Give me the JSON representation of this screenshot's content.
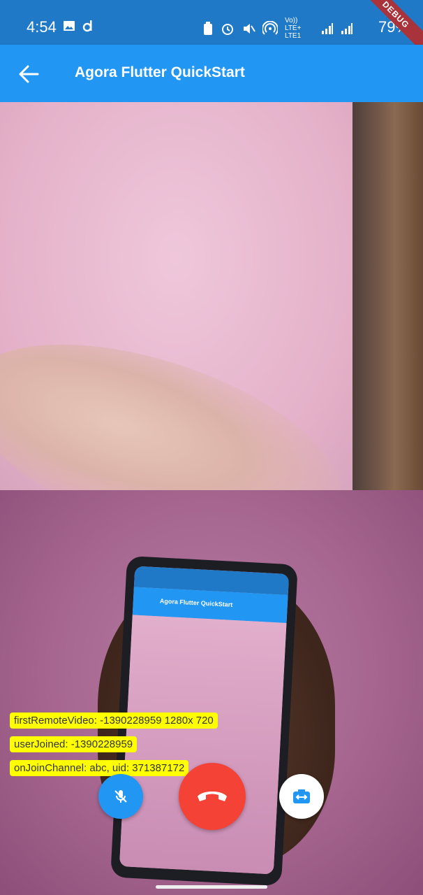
{
  "status_bar": {
    "time": "4:54",
    "network_label": "Vo)) LTE+ LTE1",
    "battery": "79%"
  },
  "debug_banner": "DEBUG",
  "app_bar": {
    "title": "Agora Flutter QuickStart",
    "back_icon": "arrow-back-icon"
  },
  "local_preview": {
    "mirrored_title": "Agora Flutter QuickStart"
  },
  "logs": [
    "firstRemoteVideo: -1390228959 1280x 720",
    "userJoined: -1390228959",
    "onJoinChannel: abc, uid: 371387172"
  ],
  "controls": {
    "mute_icon": "mic-off-icon",
    "end_call_icon": "call-end-icon",
    "switch_camera_icon": "switch-camera-icon"
  },
  "colors": {
    "primary": "#2196f3",
    "status_bar": "#1f79c7",
    "end_call": "#f44336",
    "log_bg": "#ffff00"
  }
}
